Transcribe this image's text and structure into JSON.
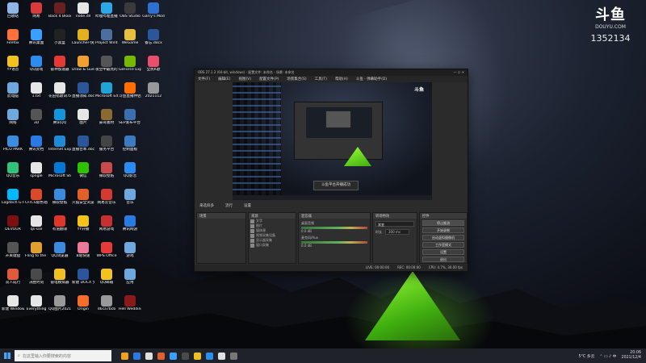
{
  "desktop": {
    "icons": [
      {
        "label": "回收站",
        "color": "#8fb6e6"
      },
      {
        "label": "网易",
        "color": "#d93b3b"
      },
      {
        "label": "Back 4 Blood Beta",
        "color": "#6a2020"
      },
      {
        "label": "node.dll",
        "color": "#e6e6e6"
      },
      {
        "label": "哔哩哔哩直播姬",
        "color": "#2aa9ea"
      },
      {
        "label": "OBS Studio",
        "color": "#3a3a3a"
      },
      {
        "label": "Garry's Mod",
        "color": "#2f6fd1"
      },
      {
        "label": "Firefox",
        "color": "#ff7139"
      },
      {
        "label": "腾讯桌面",
        "color": "#3aa0ff"
      },
      {
        "label": "小黑盒",
        "color": "#222222"
      },
      {
        "label": "Launcher-快速方式",
        "color": "#e3b020"
      },
      {
        "label": "Project Winter",
        "color": "#4c6fa0"
      },
      {
        "label": "WeGame",
        "color": "#e8c040"
      },
      {
        "label": "备忘.docx",
        "color": "#2b579a"
      },
      {
        "label": "YY语音",
        "color": "#f3c21b"
      },
      {
        "label": "QQ游戏",
        "color": "#2d8cf0"
      },
      {
        "label": "雷神加速器",
        "color": "#e53935"
      },
      {
        "label": "Draw & Guess",
        "color": "#f0a030"
      },
      {
        "label": "夜空中最亮的星.mov",
        "color": "#555555"
      },
      {
        "label": "GeForce Experience",
        "color": "#76b900"
      },
      {
        "label": "全民K歌",
        "color": "#e94f6a"
      },
      {
        "label": "此电脑",
        "color": "#6fa8dc"
      },
      {
        "label": "1.txt",
        "color": "#e6e6e6"
      },
      {
        "label": "花田错歌词.txt",
        "color": "#e6e6e6"
      },
      {
        "label": "直播须知.doc",
        "color": "#2b579a"
      },
      {
        "label": "Microsoft Edge",
        "color": "#1fa4d6"
      },
      {
        "label": "斗鱼直播伴侣",
        "color": "#ff6f00"
      },
      {
        "label": "2021112",
        "color": "#999999"
      },
      {
        "label": "网络",
        "color": "#6fa8dc"
      },
      {
        "label": "3D",
        "color": "#555555"
      },
      {
        "label": "腾讯QQ",
        "color": "#1296db"
      },
      {
        "label": "图片",
        "color": "#e6e6e6"
      },
      {
        "label": "豪哥素材",
        "color": "#8a6a30"
      },
      {
        "label": "SEP发布平台 2.0",
        "color": "#3a6fb0"
      },
      {
        "label": "PICO PARK",
        "color": "#3c8ce0"
      },
      {
        "label": "腾讯文档",
        "color": "#2a7ae4"
      },
      {
        "label": "Internet Explorer",
        "color": "#1f8ad8"
      },
      {
        "label": "直播台本.doc",
        "color": "#2b579a"
      },
      {
        "label": "服务平台",
        "color": "#444444"
      },
      {
        "label": "控制面板",
        "color": "#3c7bc0"
      },
      {
        "label": "QQ音乐",
        "color": "#31c27c"
      },
      {
        "label": "spngle",
        "color": "#e6e6e6"
      },
      {
        "label": "Microsoft Store",
        "color": "#0078d4"
      },
      {
        "label": "微信",
        "color": "#2dc100"
      },
      {
        "label": "微软壁纸",
        "color": "#c84a4a"
      },
      {
        "label": "QQ影音",
        "color": "#2a8cf0"
      },
      {
        "label": "Logitech G HUB",
        "color": "#00b8fc"
      },
      {
        "label": "CF/CS角色动画",
        "color": "#d94a2a"
      },
      {
        "label": "微软壁纸",
        "color": "#3a8be0"
      },
      {
        "label": "火狐安全浏览器",
        "color": "#e0602a"
      },
      {
        "label": "网易云音乐",
        "color": "#d33a31"
      },
      {
        "label": "音乐",
        "color": "#6fa8dc"
      },
      {
        "label": "DEVOUR",
        "color": "#7a1010"
      },
      {
        "label": "qs-sse",
        "color": "#e6e6e6"
      },
      {
        "label": "有道翻译",
        "color": "#e0362a"
      },
      {
        "label": "YY开播",
        "color": "#f3c21b"
      },
      {
        "label": "网易游戏",
        "color": "#c83030"
      },
      {
        "label": "腾讯网游",
        "color": "#2a7ae4"
      },
      {
        "label": "开关键盘",
        "color": "#555555"
      },
      {
        "label": "Fling to the Finish",
        "color": "#e0a030"
      },
      {
        "label": "QQ浏览器",
        "color": "#3a8be0"
      },
      {
        "label": "B站快速",
        "color": "#ea7a99"
      },
      {
        "label": "WPS Office",
        "color": "#e63a3a"
      },
      {
        "label": "游戏",
        "color": "#6fa8dc"
      },
      {
        "label": "双人成行",
        "color": "#e05a3a"
      },
      {
        "label": "决胜时刻",
        "color": "#4a4a4a"
      },
      {
        "label": "雷电模拟器",
        "color": "#f0c020"
      },
      {
        "label": "新建 DOCX 文档.docx",
        "color": "#2b579a"
      },
      {
        "label": "QQ邮箱",
        "color": "#f3c21b"
      },
      {
        "label": "应用",
        "color": "#6fa8dc"
      },
      {
        "label": "新建 Windows",
        "color": "#e6e6e6"
      },
      {
        "label": "Everything",
        "color": "#e6e6e6"
      },
      {
        "label": "QQ图片2021021",
        "color": "#999999"
      },
      {
        "label": "Origin",
        "color": "#f56c2d"
      },
      {
        "label": "d6ca7bcb",
        "color": "#999999"
      },
      {
        "label": "Hell Wedding",
        "color": "#8a1a1a"
      },
      {
        "label": "TeamSpeak 3",
        "color": "#2a5ab0"
      },
      {
        "label": "Stardew Valley",
        "color": "#5aa040"
      },
      {
        "label": "SD视频平台",
        "color": "#444444"
      },
      {
        "label": "AirPlayer",
        "color": "#e6e6e6"
      },
      {
        "label": "礼物.mp4",
        "color": "#777777"
      }
    ]
  },
  "brand": {
    "mark": "斗鱼",
    "site": "DOUYU.COM",
    "room": "1352134"
  },
  "obs": {
    "title": "OBS 27.1.3 (64-bit, windows) - 配置文件: 未命名 - 场景: 未命名",
    "menu": [
      "文件(F)",
      "编辑(E)",
      "视图(V)",
      "配置文件(P)",
      "场景集合(S)",
      "工具(T)",
      "帮助(H)",
      "斗鱼 · 弹幕助手(D)"
    ],
    "toast": "斗鱼平台开播成功",
    "scenes_header": "来选斜多",
    "toolbar_labels": [
      "流行",
      "设置"
    ],
    "panels": {
      "scenes": "场景",
      "sources": "来源",
      "mixer": "混音器",
      "transitions": "转场特效",
      "controls": "控件"
    },
    "sources": [
      "文字",
      "图片",
      "媒体源",
      "视频采集设备",
      "显示器采集",
      "窗口采集"
    ],
    "mixer": [
      {
        "name": "桌面音频",
        "value": "0.0 dB"
      },
      {
        "name": "麦克风/Aux",
        "value": "0.0 dB"
      }
    ],
    "transition": {
      "selected": "渐变",
      "duration_label": "时长",
      "duration": "300 ms"
    },
    "controls": [
      "停止推流",
      "开始录制",
      "启动虚拟摄像机",
      "工作室模式",
      "设置",
      "退出"
    ],
    "status": [
      "LIVE: 00:00:00",
      "REC: 00:00:00",
      "CPU: 4.7%, 30.00 fps"
    ],
    "preview_logo": "斗鱼"
  },
  "taskbar": {
    "search_placeholder": "在这里输入你要搜索的内容",
    "weather": "5°C 多云",
    "time": "20:06",
    "date": "2021/12/4",
    "apps": [
      "#f0a020",
      "#2a7ae4",
      "#e0e0e0",
      "#e06030",
      "#3aa0ff",
      "#4a4a4a",
      "#f0c020",
      "#2d8cf0",
      "#e0e0e0",
      "#777777"
    ]
  }
}
